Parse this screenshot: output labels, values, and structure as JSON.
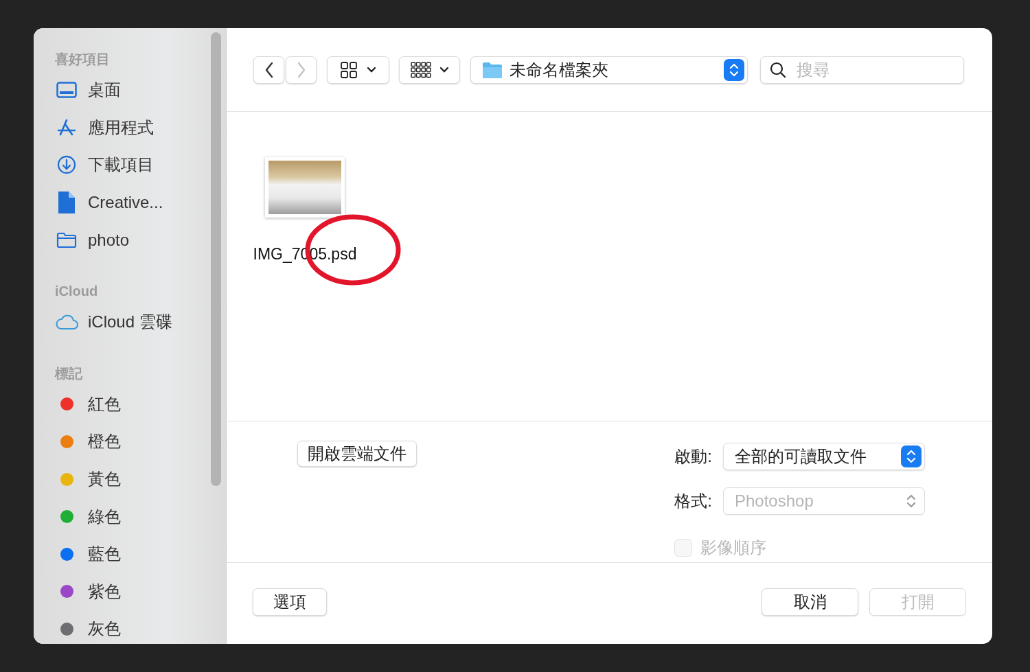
{
  "sidebar": {
    "sections": [
      {
        "heading": "喜好項目",
        "items": [
          {
            "label": "桌面",
            "kind": "desktop"
          },
          {
            "label": "應用程式",
            "kind": "apps"
          },
          {
            "label": "下載項目",
            "kind": "download"
          },
          {
            "label": "Creative...",
            "kind": "document"
          },
          {
            "label": "photo",
            "kind": "folder"
          }
        ]
      },
      {
        "heading": "iCloud",
        "items": [
          {
            "label": "iCloud 雲碟",
            "kind": "cloud"
          }
        ]
      },
      {
        "heading": "標記",
        "items": [
          {
            "label": "紅色",
            "kind": "tag",
            "color": "#f0302a"
          },
          {
            "label": "橙色",
            "kind": "tag",
            "color": "#ec7d10"
          },
          {
            "label": "黃色",
            "kind": "tag",
            "color": "#e8b40e"
          },
          {
            "label": "綠色",
            "kind": "tag",
            "color": "#1fae36"
          },
          {
            "label": "藍色",
            "kind": "tag",
            "color": "#0a6ff0"
          },
          {
            "label": "紫色",
            "kind": "tag",
            "color": "#9a47c8"
          },
          {
            "label": "灰色",
            "kind": "tag",
            "color": "#6d6d72"
          }
        ]
      }
    ]
  },
  "toolbar": {
    "back": {
      "disabled": false
    },
    "forward": {
      "disabled": true
    },
    "location": "未命名檔案夾",
    "search": {
      "placeholder": "搜尋"
    }
  },
  "files": [
    {
      "name": "IMG_7005.psd"
    }
  ],
  "options": {
    "cloud_button": "開啟雲端文件",
    "enable": {
      "label": "啟動:",
      "value": "全部的可讀取文件",
      "disabled": false
    },
    "format": {
      "label": "格式:",
      "value": "Photoshop",
      "disabled": true
    },
    "image_sequence": {
      "label": "影像順序",
      "checked": false,
      "disabled": true
    }
  },
  "footer": {
    "options_button": {
      "label": "選項",
      "disabled": false
    },
    "cancel_button": {
      "label": "取消",
      "disabled": false
    },
    "open_button": {
      "label": "打開",
      "disabled": true
    }
  }
}
